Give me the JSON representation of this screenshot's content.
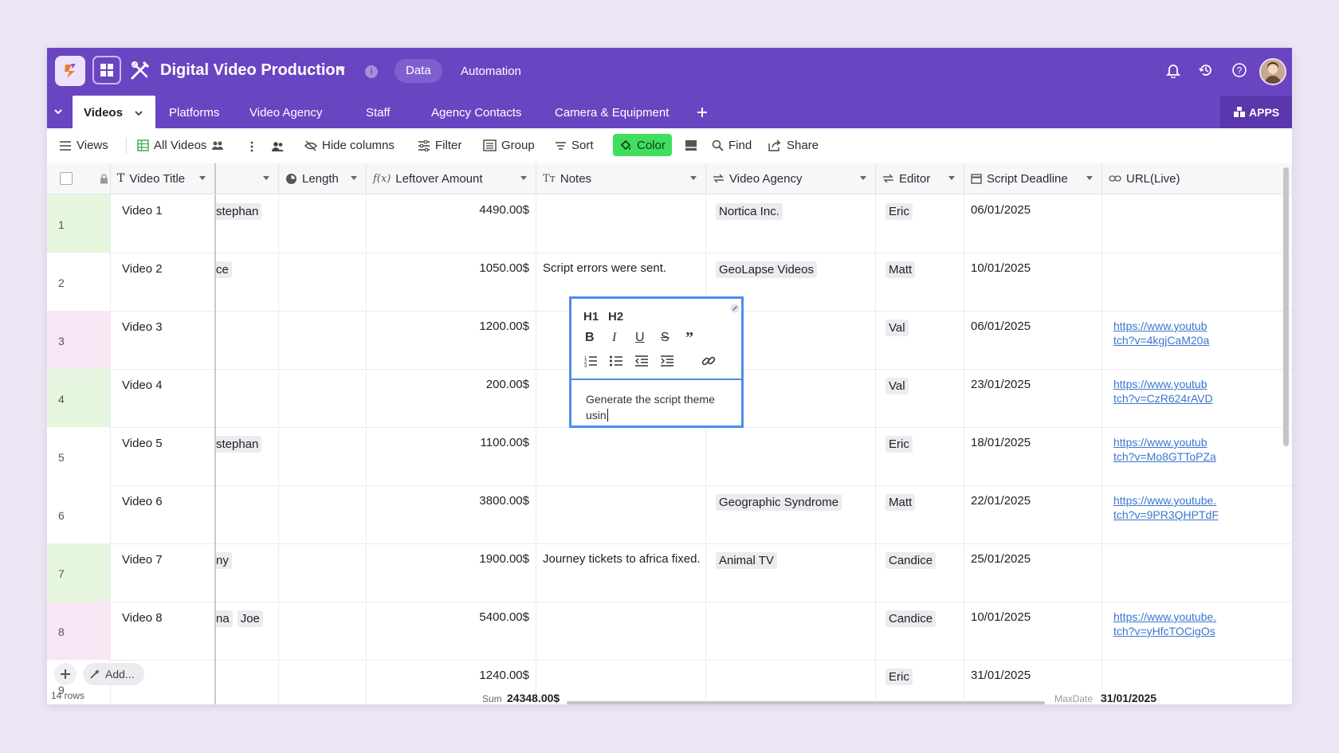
{
  "app": {
    "title": "Digital Video Production",
    "nav": [
      "Data",
      "Automation"
    ]
  },
  "tabs": {
    "active": "Videos",
    "items": [
      "Platforms",
      "Video Agency",
      "Staff",
      "Agency Contacts",
      "Camera & Equipment"
    ],
    "apps_label": "APPS"
  },
  "toolbar": {
    "views": "Views",
    "all_videos": "All Videos",
    "hide_columns": "Hide columns",
    "filter": "Filter",
    "group": "Group",
    "sort": "Sort",
    "color": "Color",
    "find": "Find",
    "share": "Share"
  },
  "columns": {
    "video_title": "Video Title",
    "length": "Length",
    "leftover": "Leftover Amount",
    "notes": "Notes",
    "agency": "Video Agency",
    "editor": "Editor",
    "deadline": "Script Deadline",
    "url": "URL(Live)"
  },
  "rows": [
    {
      "num": "1",
      "title": "Video 1",
      "staff": [
        "stephan"
      ],
      "amount": "4490.00$",
      "notes": "",
      "agency": "Nortica Inc.",
      "editor": "Eric",
      "deadline": "06/01/2025",
      "url1": "",
      "url2": ""
    },
    {
      "num": "2",
      "title": "Video 2",
      "staff": [
        "ce"
      ],
      "amount": "1050.00$",
      "notes": "Script errors were sent.",
      "agency": "GeoLapse Videos",
      "editor": "Matt",
      "deadline": "10/01/2025",
      "url1": "",
      "url2": ""
    },
    {
      "num": "3",
      "title": "Video 3",
      "staff": [],
      "amount": "1200.00$",
      "notes": "",
      "agency": "",
      "editor": "Val",
      "deadline": "06/01/2025",
      "url1": "https://www.youtub",
      "url2": "tch?v=4kgjCaM20a"
    },
    {
      "num": "4",
      "title": "Video 4",
      "staff": [],
      "amount": "200.00$",
      "notes": "",
      "agency": "",
      "editor": "Val",
      "deadline": "23/01/2025",
      "url1": "https://www.youtub",
      "url2": "tch?v=CzR624rAVD"
    },
    {
      "num": "5",
      "title": "Video 5",
      "staff": [
        "stephan"
      ],
      "amount": "1100.00$",
      "notes": "",
      "agency": "",
      "editor": "Eric",
      "deadline": "18/01/2025",
      "url1": "https://www.youtub",
      "url2": "tch?v=Mo8GTToPZa"
    },
    {
      "num": "6",
      "title": "Video 6",
      "staff": [],
      "amount": "3800.00$",
      "notes": "",
      "agency": "Geographic Syndrome",
      "editor": "Matt",
      "deadline": "22/01/2025",
      "url1": "https://www.youtube.",
      "url2": "tch?v=9PR3QHPTdF"
    },
    {
      "num": "7",
      "title": "Video 7",
      "staff": [
        "ny"
      ],
      "amount": "1900.00$",
      "notes": "Journey tickets to africa fixed.",
      "agency": "Animal TV",
      "editor": "Candice",
      "deadline": "25/01/2025",
      "url1": "",
      "url2": ""
    },
    {
      "num": "8",
      "title": "Video 8",
      "staff": [
        "na",
        "Joe"
      ],
      "amount": "5400.00$",
      "notes": "",
      "agency": "",
      "editor": "Candice",
      "deadline": "10/01/2025",
      "url1": "https://www.youtube.",
      "url2": "tch?v=yHfcTOCigOs"
    },
    {
      "num": "9",
      "title": "",
      "staff": [],
      "amount": "1240.00$",
      "notes": "",
      "agency": "",
      "editor": "Eric",
      "deadline": "31/01/2025",
      "url1": "",
      "url2": ""
    }
  ],
  "row_colors": [
    "#e6f6df",
    "#ffffff",
    "#f7e6f3",
    "#e6f6df",
    "#ffffff",
    "#ffffff",
    "#e6f6df",
    "#f7e6f3",
    "#ffffff"
  ],
  "editor_popup": {
    "h1": "H1",
    "h2": "H2",
    "text": "Generate the script theme usin"
  },
  "footer": {
    "rows_count": "14 rows",
    "add_label": "Add...",
    "sum_label": "Sum",
    "sum_value": "24348.00$",
    "max_label": "MaxDate",
    "max_value": "31/01/2025"
  },
  "colors": {
    "header_purple": "#6a45c2",
    "color_button": "#3fdf5d",
    "link": "#3a76d0"
  }
}
